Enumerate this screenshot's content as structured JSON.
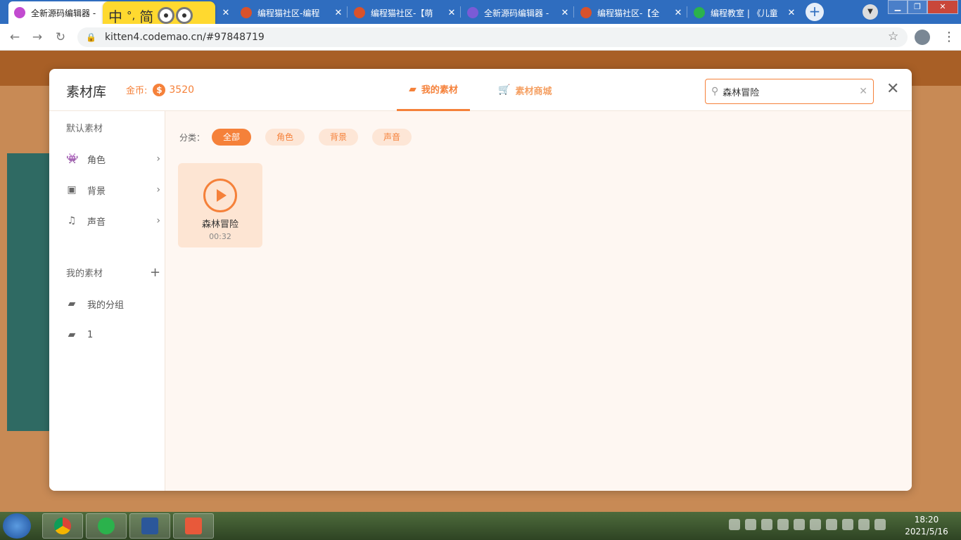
{
  "browser": {
    "tabs": [
      {
        "title": "全新源码编辑器 -",
        "color": "#c24bd0"
      },
      {
        "title": "",
        "color": "#f5a623"
      },
      {
        "title": "编程猫社区-编程",
        "color": "#d9522b"
      },
      {
        "title": "编程猫社区-【萌",
        "color": "#d9522b"
      },
      {
        "title": "全新源码编辑器 -",
        "color": "#7b5bd6"
      },
      {
        "title": "编程猫社区-【全",
        "color": "#d9522b"
      },
      {
        "title": "编程教室 | 《儿童",
        "color": "#2bb24c"
      }
    ],
    "tab_close": "✕",
    "new_tab": "+",
    "url": "kitten4.codemao.cn/#97848719"
  },
  "ime": {
    "lang": "中",
    "punct": "°,",
    "mode": "简"
  },
  "modal": {
    "title": "素材库",
    "coins_label": "金币:",
    "coin_symbol": "$",
    "coins_value": "3520",
    "tab_mine": "我的素材",
    "tab_shop": "素材商城",
    "search_value": "森林冒险",
    "close": "✕"
  },
  "sidebar": {
    "default_title": "默认素材",
    "default_items": [
      {
        "label": "角色",
        "icon": "character-icon"
      },
      {
        "label": "背景",
        "icon": "image-icon"
      },
      {
        "label": "声音",
        "icon": "music-icon"
      }
    ],
    "mine_title": "我的素材",
    "mine_items": [
      {
        "label": "我的分组",
        "icon": "folder-icon"
      },
      {
        "label": "1",
        "icon": "folder-icon"
      }
    ]
  },
  "filter": {
    "label": "分类：",
    "chips": [
      "全部",
      "角色",
      "背景",
      "声音"
    ],
    "active": "全部"
  },
  "assets": [
    {
      "name": "森林冒险",
      "duration": "00:32",
      "type": "sound"
    }
  ],
  "taskbar": {
    "time": "18:20",
    "date": "2021/5/16"
  },
  "colors": {
    "accent": "#f5813a",
    "tab_bar": "#2f6dbf"
  }
}
